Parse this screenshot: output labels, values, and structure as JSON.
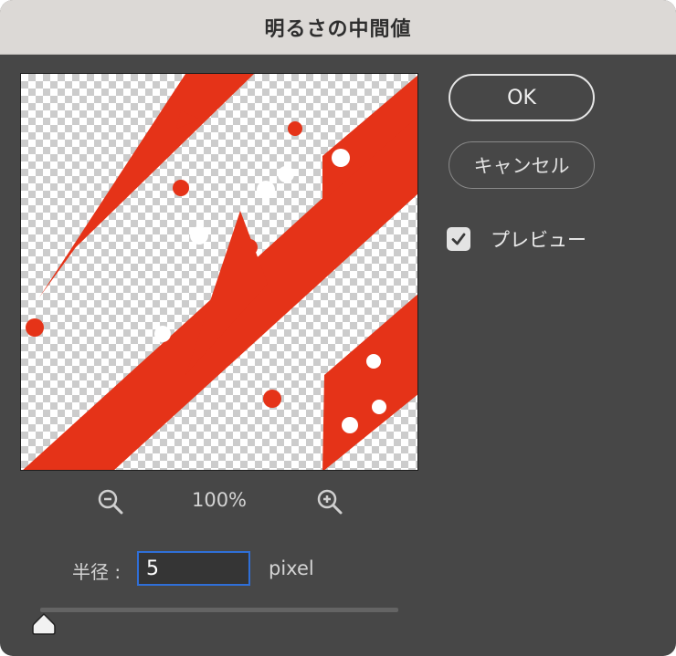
{
  "dialog": {
    "title": "明るさの中間値",
    "ok_label": "OK",
    "cancel_label": "キャンセル",
    "preview_label": "プレビュー",
    "preview_checked": true
  },
  "zoom": {
    "level": "100%",
    "zoom_out_icon": "zoom-out-icon",
    "zoom_in_icon": "zoom-in-icon"
  },
  "radius": {
    "label": "半径 :",
    "value": "5",
    "unit": "pixel",
    "slider_fraction": 0.0
  },
  "colors": {
    "accent": "#2f6fd8",
    "preview_red": "#e53318",
    "dialog_bg": "#474747"
  }
}
